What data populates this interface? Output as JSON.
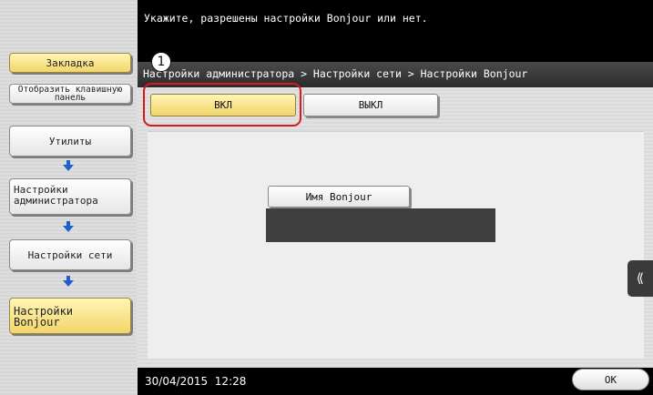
{
  "header": {
    "message": "Укажите, разрешены настройки Bonjour или нет.",
    "breadcrumb": "Настройки администратора > Настройки сети > Настройки Bonjour"
  },
  "sidebar": {
    "bookmark": "Закладка",
    "keypad": "Отобразить клавишную панель",
    "steps": [
      {
        "label": "Утилиты"
      },
      {
        "label": "Настройки администратора"
      },
      {
        "label": "Настройки сети"
      },
      {
        "label": "Настройки Bonjour"
      }
    ]
  },
  "main": {
    "on_label": "ВКЛ",
    "off_label": "ВЫКЛ",
    "bonjour_name_label": "Имя Bonjour",
    "bonjour_name_value": "",
    "callout_number": "1",
    "side_tab_icon": "double-chevron-left-icon"
  },
  "footer": {
    "datetime": "30/04/2015  12:28",
    "ok_label": "OK"
  },
  "colors": {
    "accent_yellow": "#f3d56a",
    "highlight_red": "#d8191a",
    "arrow_blue": "#1f5fd0"
  }
}
